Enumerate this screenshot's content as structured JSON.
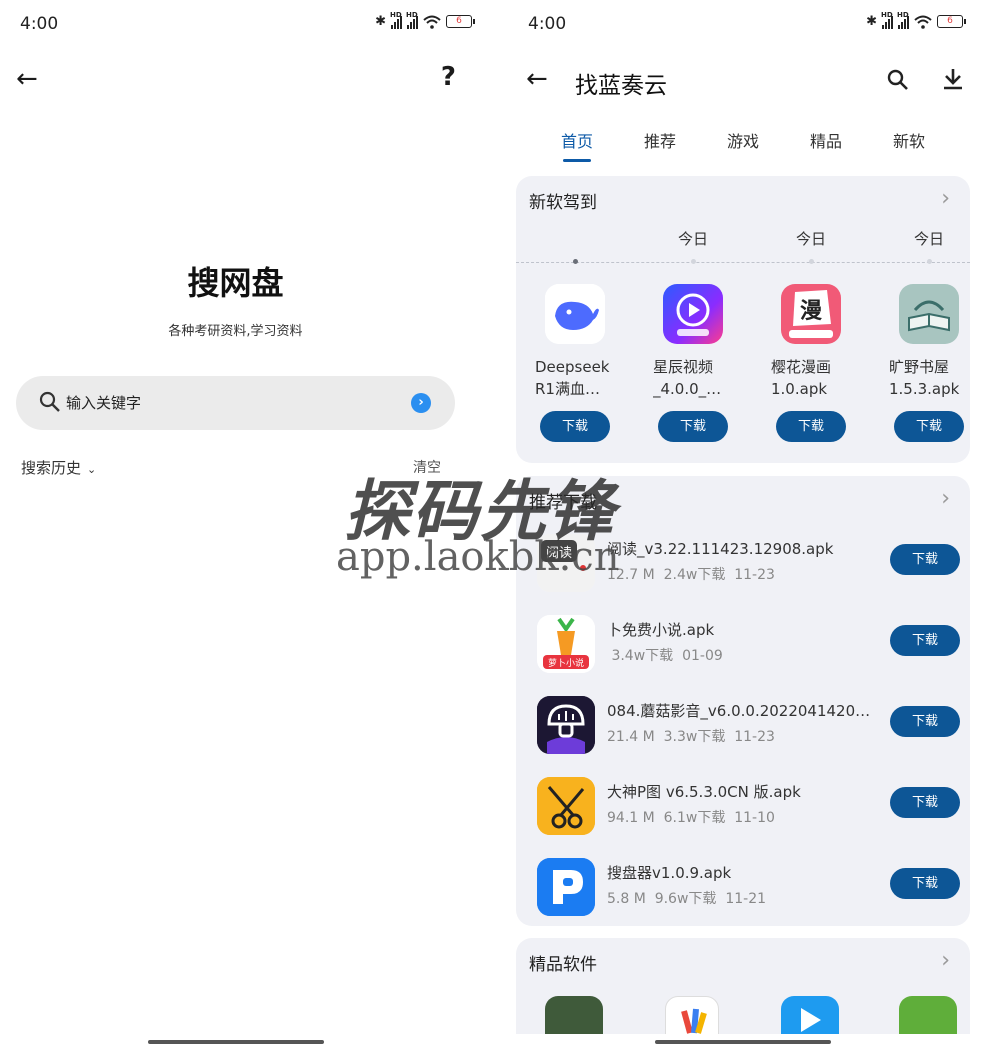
{
  "left": {
    "status": {
      "time": "4:00",
      "battery": "6"
    },
    "title": "搜网盘",
    "subtitle": "各种考研资料,学习资料",
    "search": {
      "placeholder": "输入关键字"
    },
    "history_label": "搜索历史",
    "clear_label": "清空",
    "help_glyph": "?"
  },
  "right": {
    "status": {
      "time": "4:00",
      "battery": "6"
    },
    "title": "找蓝奏云",
    "tabs": [
      "首页",
      "推荐",
      "游戏",
      "精品",
      "新软"
    ],
    "active_tab": 0,
    "new_section": {
      "title": "新软驾到",
      "days": [
        "今日",
        "今日",
        "今日"
      ],
      "apps": [
        {
          "name": "Deepseek R1满血…",
          "button": "下载",
          "icon": "whale-icon",
          "color": "#4d6bfe"
        },
        {
          "name": "星辰视频_4.0.0_…",
          "button": "下载",
          "icon": "play-icon",
          "color": "#6a3cff"
        },
        {
          "name": "樱花漫画1.0.apk",
          "button": "下载",
          "icon": "manga-icon",
          "color": "#e94b6b"
        },
        {
          "name": "旷野书屋1.5.3.apk",
          "button": "下载",
          "icon": "book-icon",
          "color": "#8fb5b0"
        }
      ]
    },
    "rec_section": {
      "title": "推荐下载",
      "apps": [
        {
          "name": "阅读_v3.22.111423.12908.apk",
          "size": "12.7 M",
          "downloads": "2.4w下载",
          "date": "11-23",
          "button": "下载",
          "icon": "read-icon",
          "icon_text": "阅读"
        },
        {
          "name": "卜免费小说.apk",
          "size": "",
          "downloads": "3.4w下载",
          "date": "01-09",
          "button": "下载",
          "icon": "carrot-icon",
          "icon_text": "萝卜小说"
        },
        {
          "name": "084.蘑菇影音_v6.0.0.2022041420…",
          "size": "21.4 M",
          "downloads": "3.3w下载",
          "date": "11-23",
          "button": "下载",
          "icon": "mushroom-icon",
          "icon_text": ""
        },
        {
          "name": "大神P图 v6.5.3.0CN 版.apk",
          "size": "94.1 M",
          "downloads": "6.1w下载",
          "date": "11-10",
          "button": "下载",
          "icon": "scissors-icon",
          "icon_text": ""
        },
        {
          "name": "搜盘器v1.0.9.apk",
          "size": "5.8 M",
          "downloads": "9.6w下载",
          "date": "11-21",
          "button": "下载",
          "icon": "p-letter-icon",
          "icon_text": ""
        }
      ]
    },
    "premium_section": {
      "title": "精品软件"
    }
  },
  "watermark": {
    "big": "探码先锋",
    "small": "app.laokbk.cn"
  },
  "colors": {
    "accent": "#0d5aa7",
    "button": "#0d5696",
    "card_bg": "#f0f1f6"
  }
}
